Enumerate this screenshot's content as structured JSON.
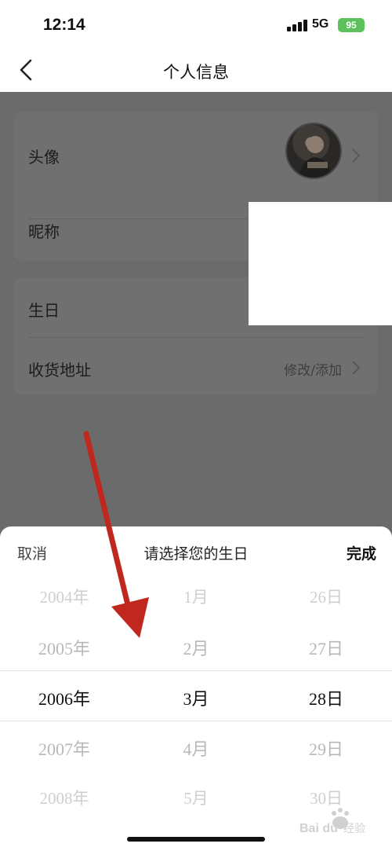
{
  "status": {
    "time": "12:14",
    "network": "5G",
    "battery": "95"
  },
  "nav": {
    "title": "个人信息",
    "back_icon": "chevron-left-icon"
  },
  "profile": {
    "avatar_label": "头像",
    "nickname_label": "昵称",
    "birthday_label": "生日",
    "address_label": "收货地址",
    "address_value": "修改/添加"
  },
  "sheet": {
    "cancel_label": "取消",
    "title": "请选择您的生日",
    "done_label": "完成",
    "years": [
      "2004年",
      "2005年",
      "2006年",
      "2007年",
      "2008年"
    ],
    "months": [
      "1月",
      "2月",
      "3月",
      "4月",
      "5月"
    ],
    "days": [
      "26日",
      "27日",
      "28日",
      "29日",
      "30日"
    ],
    "selected": {
      "year": "2006年",
      "month": "3月",
      "day": "28日"
    }
  },
  "watermark": {
    "text": "Bai du 经验"
  },
  "colors": {
    "annotation_arrow": "#c0271f",
    "overlay": "#6b6b6b",
    "battery": "#5cc05c"
  }
}
